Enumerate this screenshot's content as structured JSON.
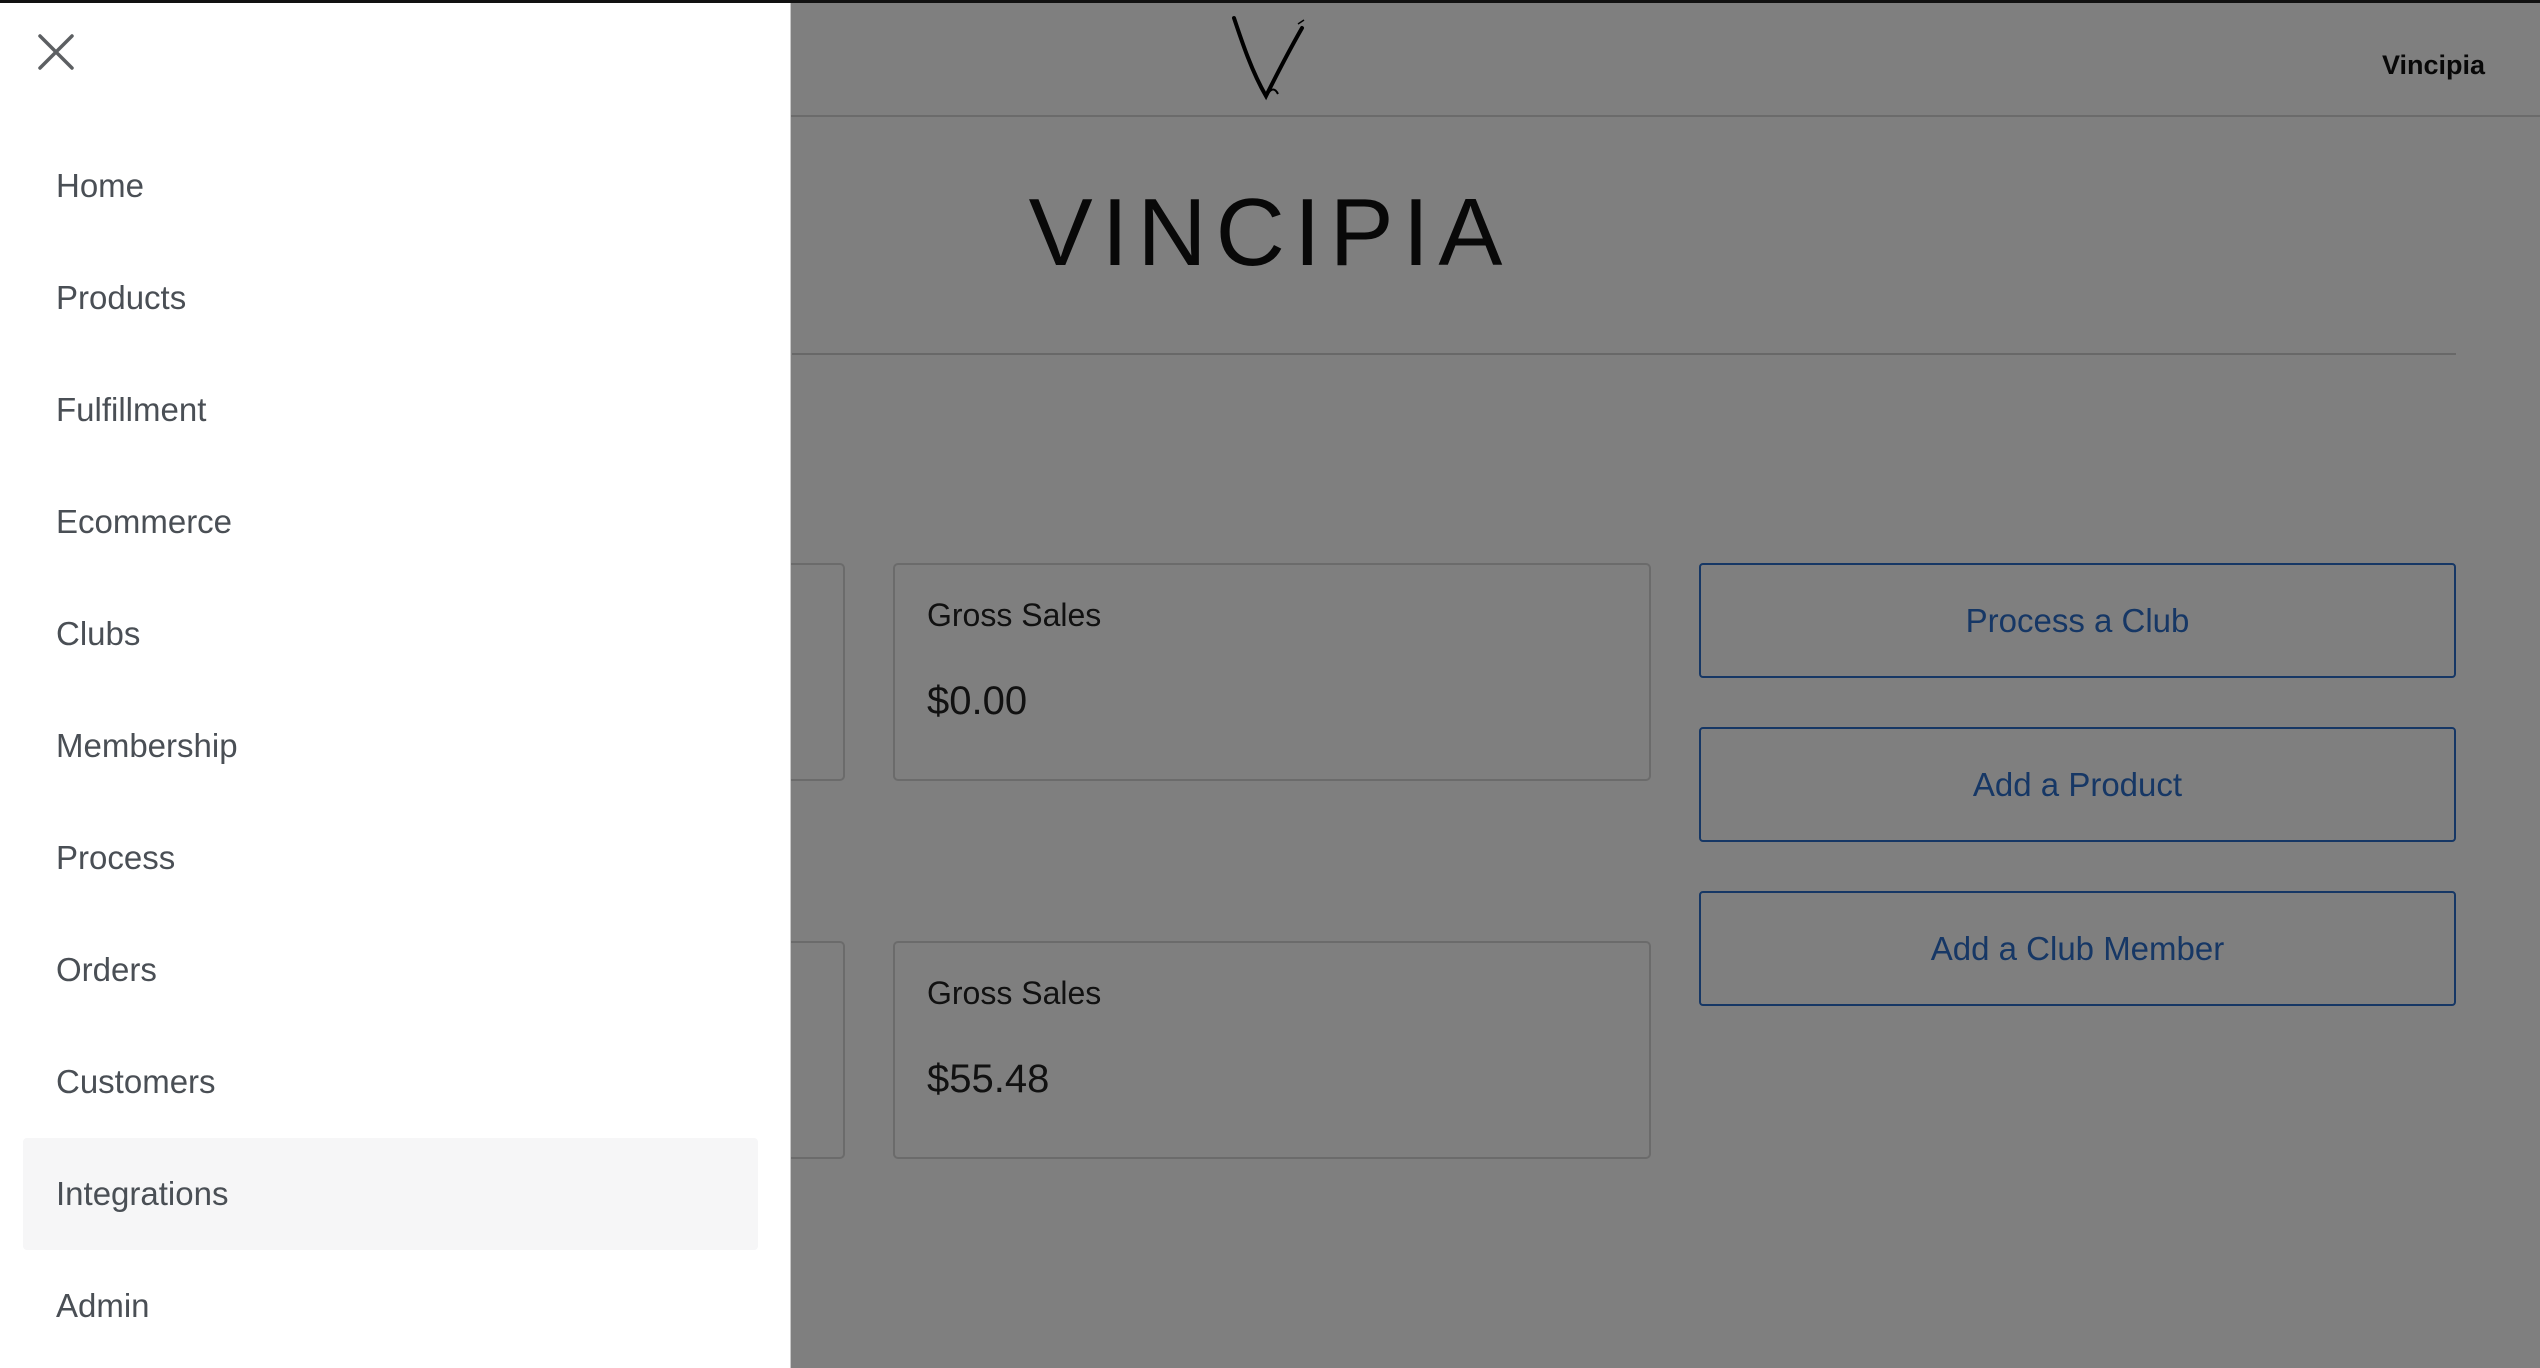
{
  "header": {
    "store_name": "Vincipia",
    "logo_icon": "v-signature-logo"
  },
  "page": {
    "title": "VINCIPIA"
  },
  "stats": [
    {
      "label": "Gross Sales",
      "value": "$0.00"
    },
    {
      "label": "Gross Sales",
      "value": "$55.48"
    }
  ],
  "actions": [
    {
      "label": "Process a Club"
    },
    {
      "label": "Add a Product"
    },
    {
      "label": "Add a Club Member"
    }
  ],
  "drawer": {
    "close_icon": "close-icon",
    "items": [
      {
        "label": "Home"
      },
      {
        "label": "Products"
      },
      {
        "label": "Fulfillment"
      },
      {
        "label": "Ecommerce"
      },
      {
        "label": "Clubs"
      },
      {
        "label": "Membership"
      },
      {
        "label": "Process"
      },
      {
        "label": "Orders"
      },
      {
        "label": "Customers"
      },
      {
        "label": "Integrations",
        "active": true
      },
      {
        "label": "Admin"
      }
    ]
  },
  "colors": {
    "accent": "#2c6ecb",
    "overlay": "rgba(0,0,0,0.5)",
    "active_item_bg": "#f6f6f7"
  }
}
